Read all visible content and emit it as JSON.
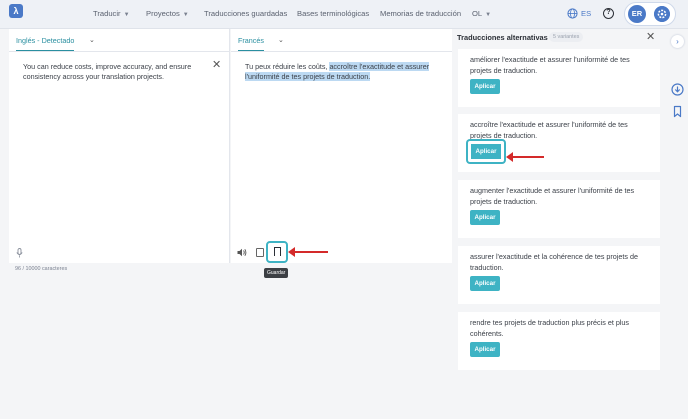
{
  "topbar": {
    "logo": "λ",
    "nav": [
      {
        "label": "Traducir",
        "has_menu": true
      },
      {
        "label": "Proyectos",
        "has_menu": true
      },
      {
        "label": "Traducciones guardadas",
        "has_menu": false
      },
      {
        "label": "Bases terminológicas",
        "has_menu": false
      },
      {
        "label": "Memorias de traducción",
        "has_menu": false
      },
      {
        "label": "OL",
        "has_menu": true
      }
    ],
    "language": "ES",
    "help": "?",
    "avatar_initials": "ER"
  },
  "source": {
    "language_tab": "Inglés - Detectado",
    "text": "You can reduce costs, improve accuracy, and ensure consistency across your translation projects.",
    "char_count": "96 / 10000 caracteres"
  },
  "target": {
    "language_tab": "Francés",
    "text_plain": "Tu peux réduire les coûts, ",
    "text_highlight": "accroître l'exactitude et assurer l'uniformité de tes projets de traduction.",
    "save_tooltip": "Guardar"
  },
  "alternatives": {
    "title": "Traducciones alternativas",
    "badge": "5 variantes",
    "apply_label": "Aplicar",
    "items": [
      "améliorer l'exactitude et assurer l'uniformité de tes projets de traduction.",
      "accroître l'exactitude et assurer l'uniformité de tes projets de traduction.",
      "augmenter l'exactitude et assurer l'uniformité de tes projets de traduction.",
      "assurer l'exactitude et la cohérence de tes projets de traduction.",
      "rendre tes projets de traduction plus précis et plus cohérents."
    ]
  },
  "colors": {
    "accent": "#3eb3c4",
    "brand": "#4a79c7",
    "highlight": "#bcd9f2",
    "annotation_arrow": "#d42a2a"
  },
  "icons": [
    "logo-icon",
    "chevron-down-icon",
    "globe-icon",
    "help-icon",
    "gear-icon",
    "close-icon",
    "microphone-icon",
    "speaker-icon",
    "copy-icon",
    "bookmark-icon",
    "chevron-right-icon",
    "download-icon"
  ]
}
